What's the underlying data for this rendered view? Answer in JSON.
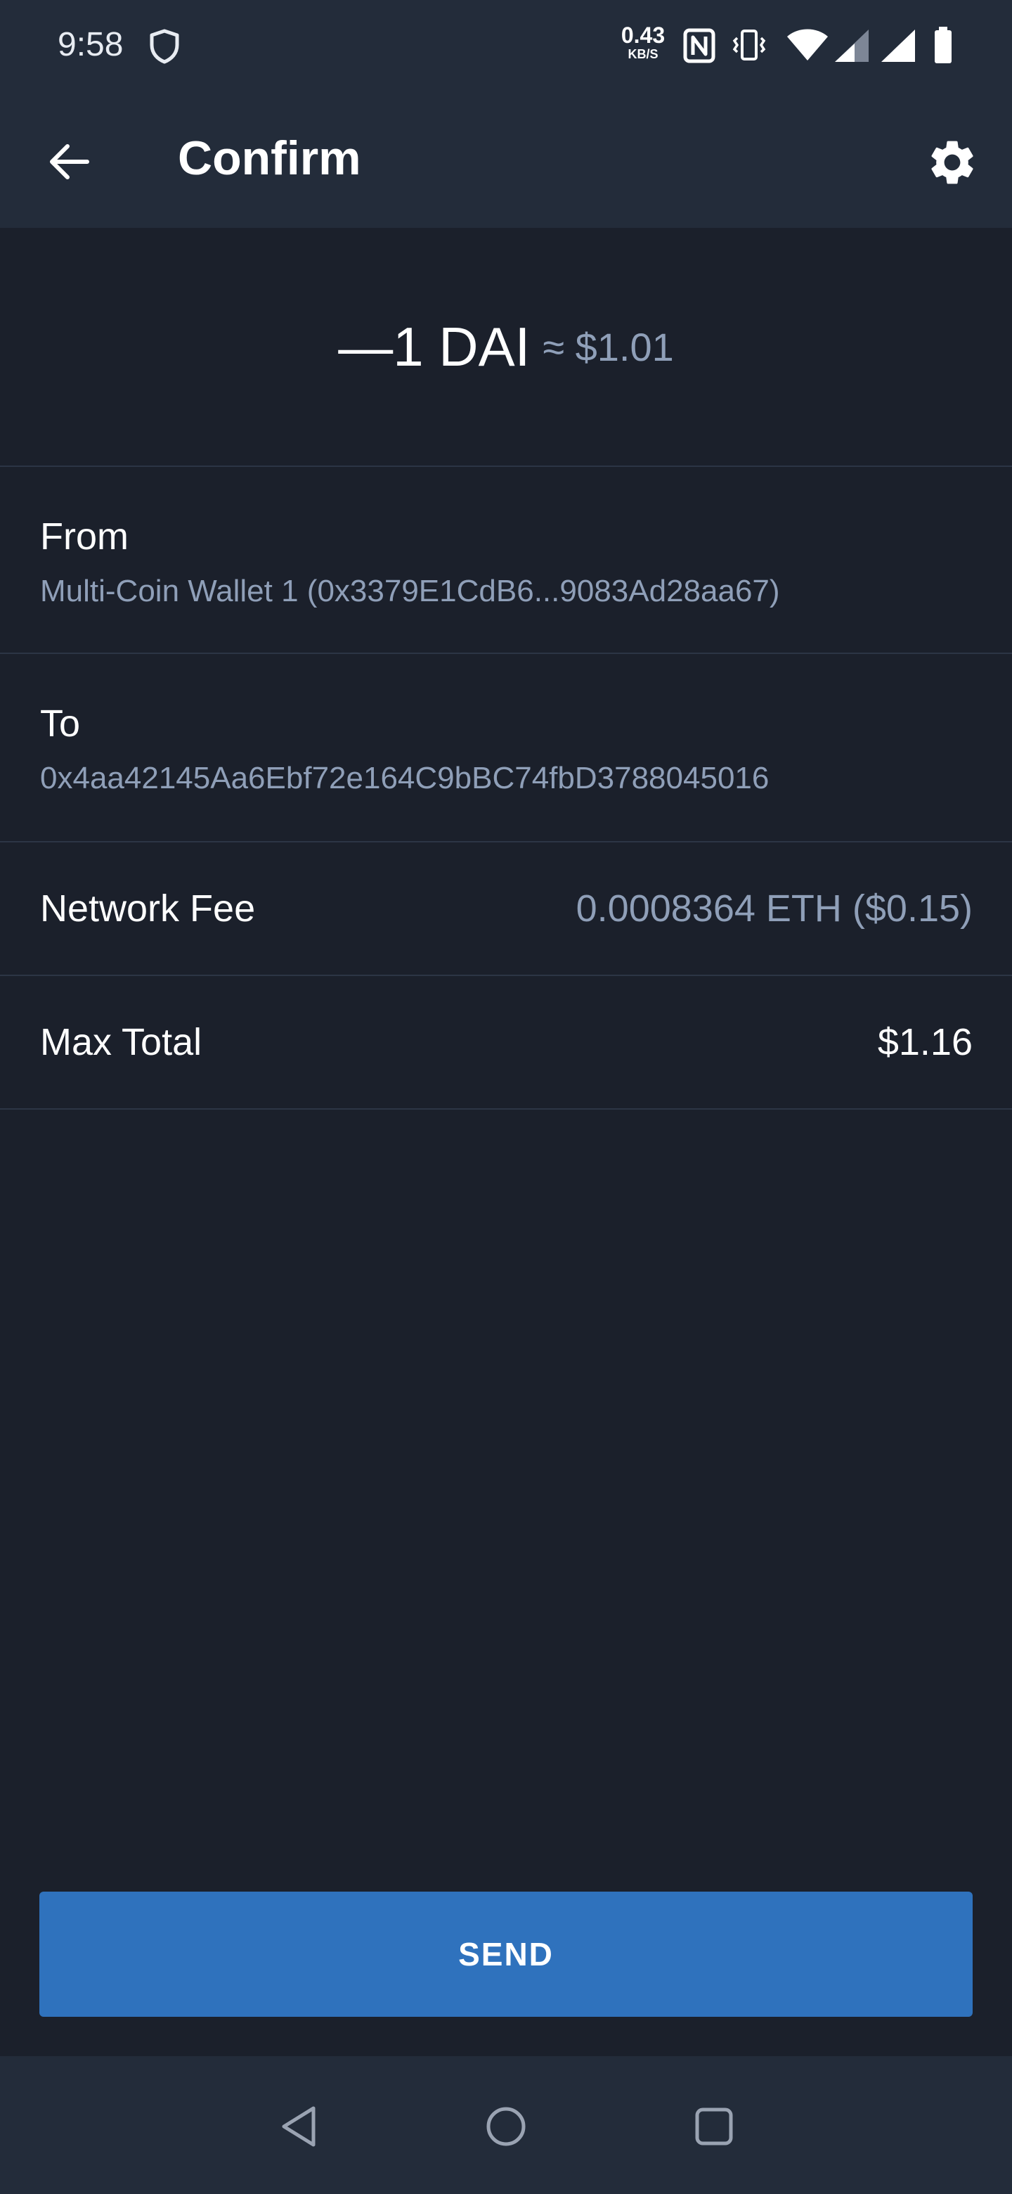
{
  "status_bar": {
    "time": "9:58",
    "speed_value": "0.43",
    "speed_unit": "KB/S",
    "icons": [
      "shield-icon",
      "nfc-icon",
      "vibrate-icon",
      "wifi-icon",
      "signal-icon",
      "signal-icon",
      "battery-icon"
    ]
  },
  "header": {
    "title": "Confirm",
    "back_icon": "arrow-left-icon",
    "settings_icon": "gear-icon"
  },
  "amount": {
    "value": "—1 DAI",
    "approx": "≈ $1.01"
  },
  "from": {
    "label": "From",
    "value": "Multi-Coin Wallet 1 (0x3379E1CdB6...9083Ad28aa67)"
  },
  "to": {
    "label": "To",
    "value": "0x4aa42145Aa6Ebf72e164C9bBC74fbD3788045016"
  },
  "network_fee": {
    "label": "Network Fee",
    "value": "0.0008364 ETH ($0.15)"
  },
  "max_total": {
    "label": "Max Total",
    "value": "$1.16"
  },
  "send_button": {
    "label": "SEND"
  },
  "nav_bar": {
    "icons": [
      "back-triangle-icon",
      "home-circle-icon",
      "recents-square-icon"
    ]
  },
  "colors": {
    "background": "#1b202b",
    "header": "#232c3a",
    "muted_text": "#8f9fb8",
    "accent": "#2f72bd",
    "divider": "#2c3545"
  }
}
